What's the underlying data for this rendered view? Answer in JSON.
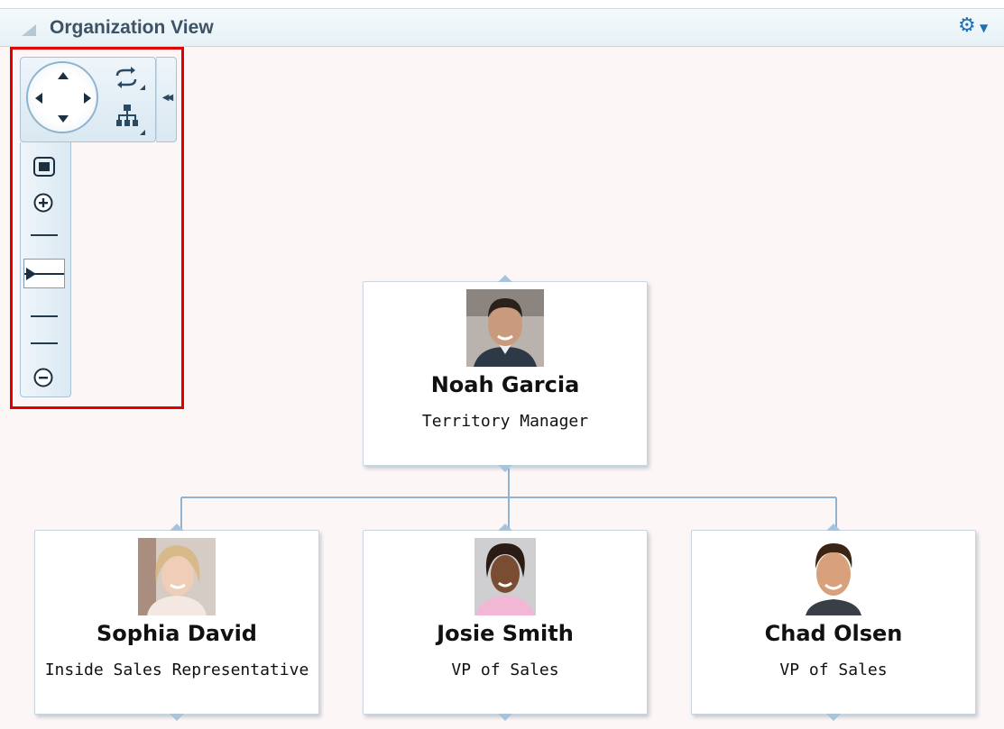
{
  "header": {
    "title": "Organization View",
    "collapse_icon": "triangle-collapse-icon",
    "settings_icon": "gear-icon"
  },
  "controls": {
    "pan_icon": "pan-control-icon",
    "refresh_layout_icon": "refresh-layout-icon",
    "hierarchy_icon": "hierarchy-icon",
    "collapse_panel_icon": "double-chevron-left-icon",
    "zoom_to_fit_icon": "zoom-fit-icon",
    "zoom_in_icon": "zoom-in-icon",
    "zoom_out_icon": "zoom-out-icon",
    "zoom_level_fraction": 0.4
  },
  "root": {
    "name": "Noah Garcia",
    "title": "Territory Manager"
  },
  "children": [
    {
      "name": "Sophia David",
      "title": "Inside Sales Representative"
    },
    {
      "name": "Josie Smith",
      "title": "VP of Sales"
    },
    {
      "name": "Chad Olsen",
      "title": "VP of Sales"
    }
  ],
  "colors": {
    "accent": "#1f6fb5",
    "connector": "#8fb3d0",
    "highlight": "#e00000"
  }
}
